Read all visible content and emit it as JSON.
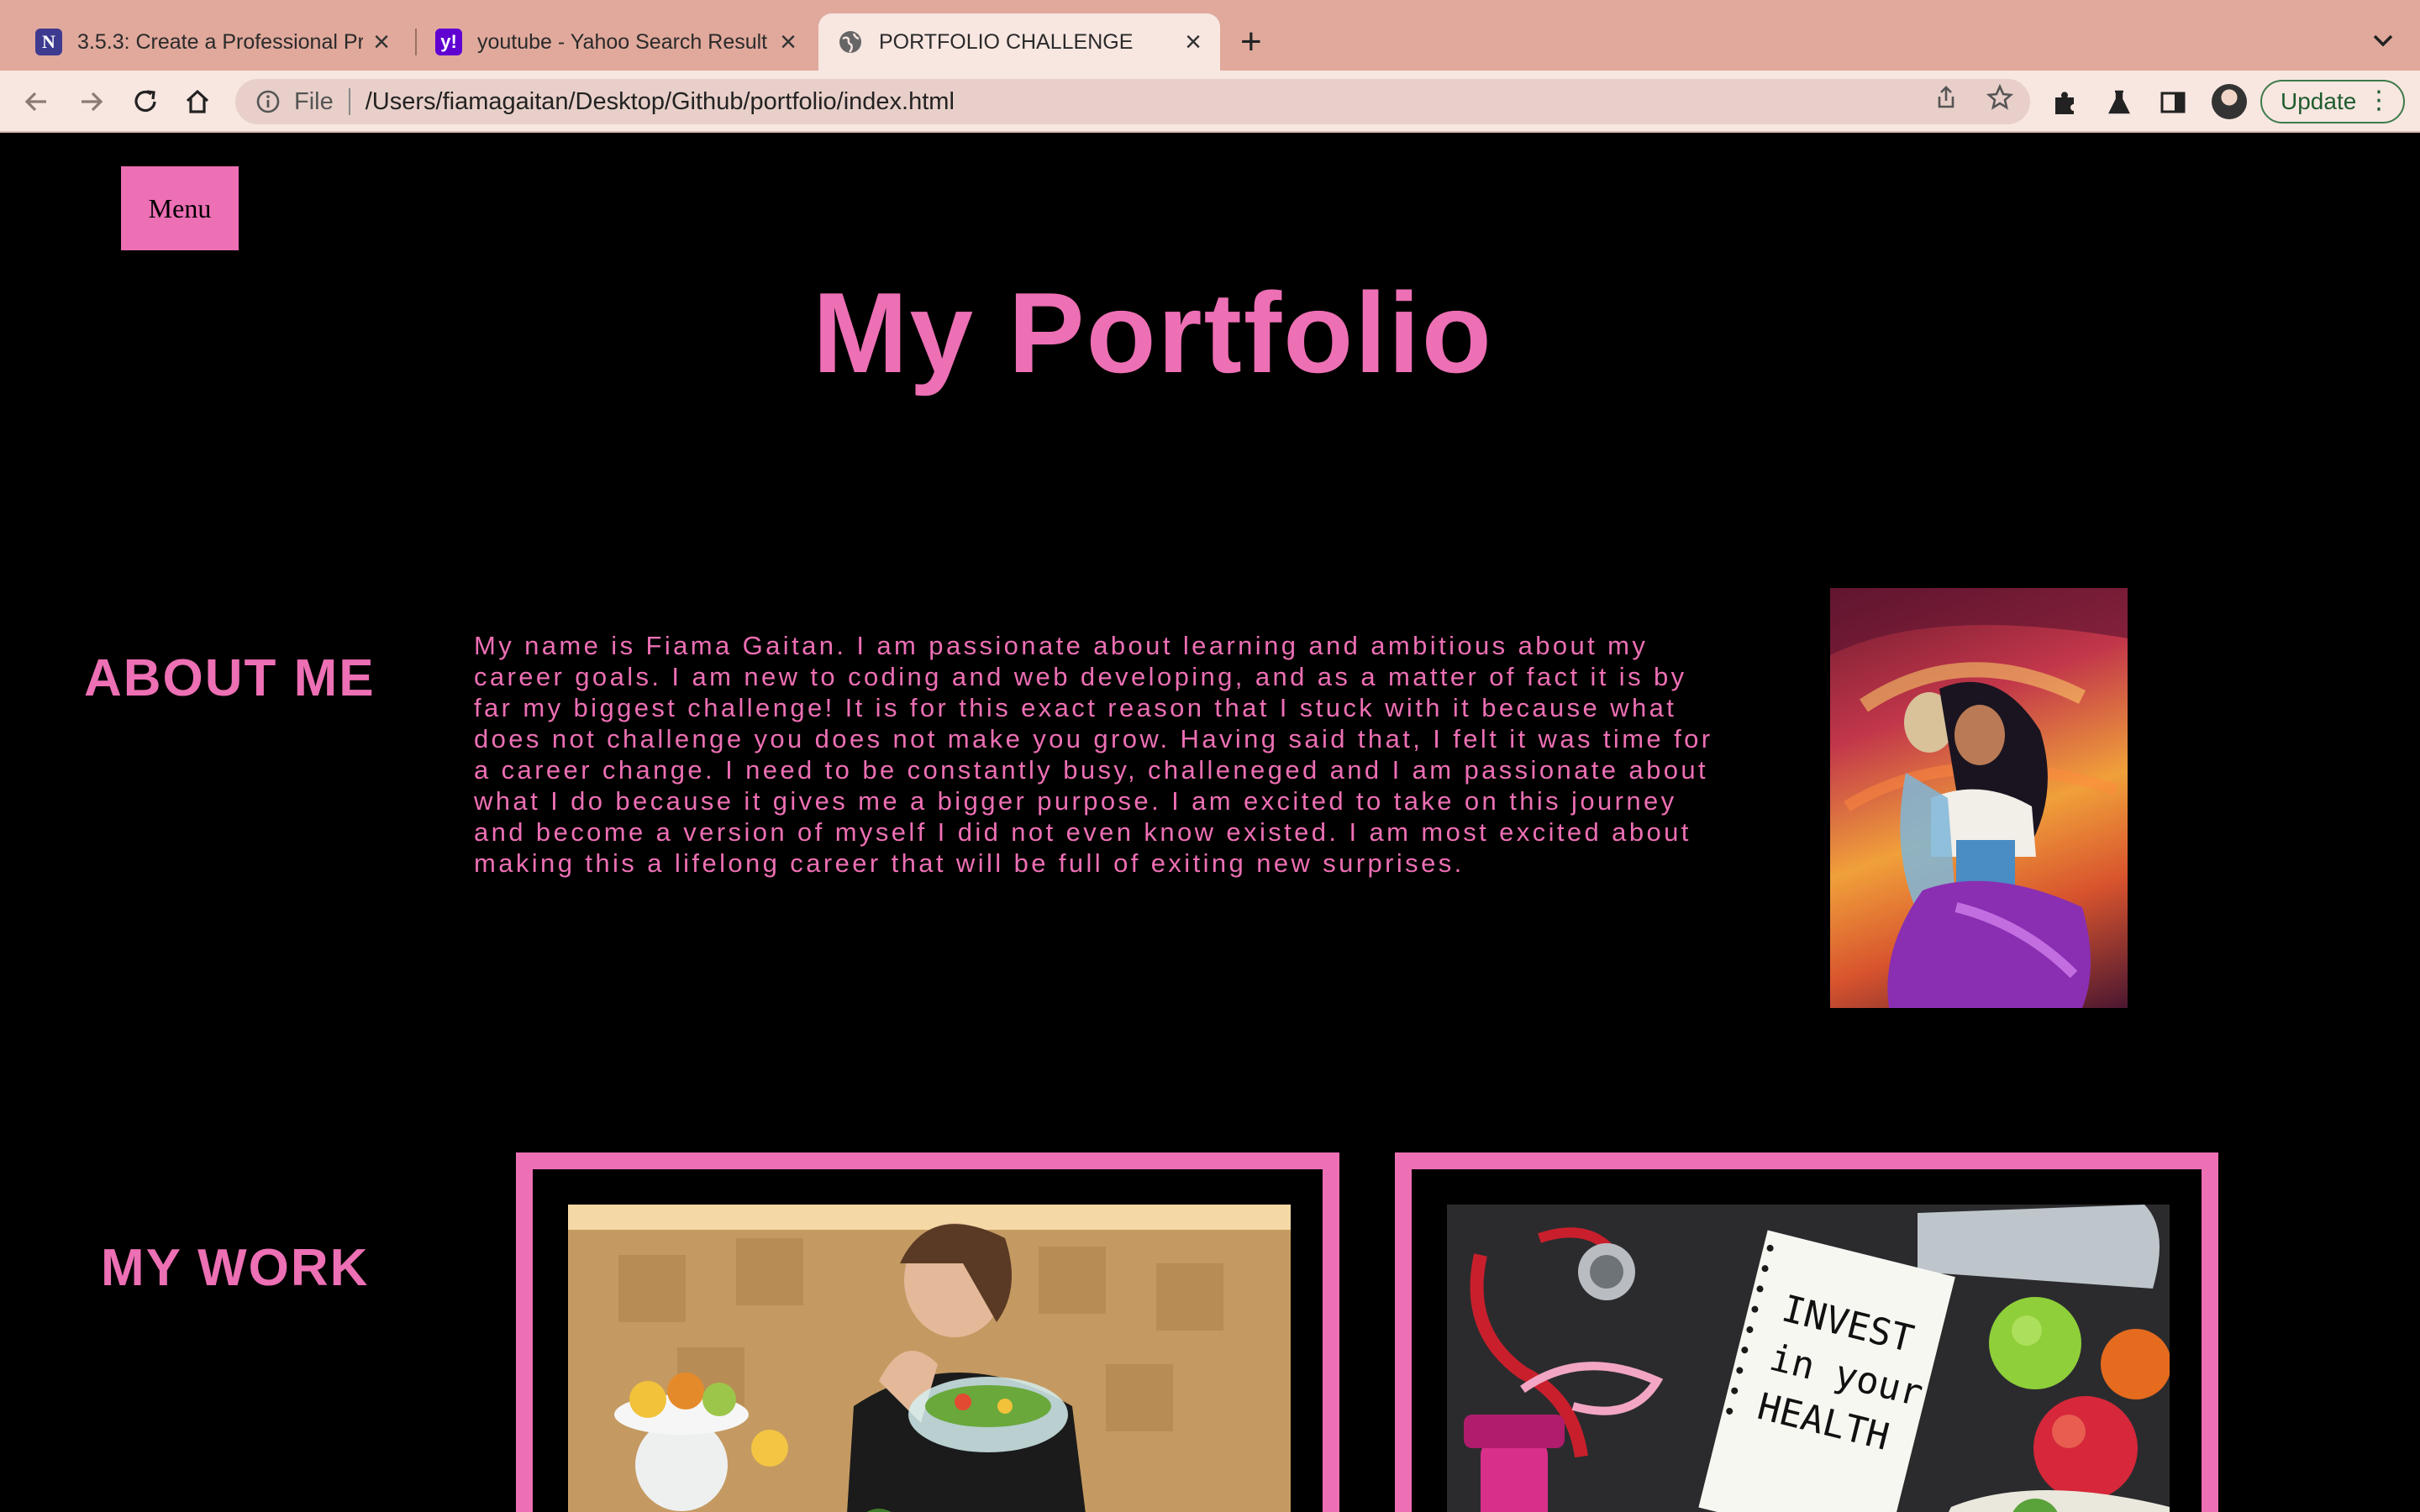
{
  "browser": {
    "tabs": [
      {
        "title": "3.5.3: Create a Professional Pr",
        "favicon": "N",
        "active": false
      },
      {
        "title": "youtube - Yahoo Search Result",
        "favicon": "y!",
        "active": false
      },
      {
        "title": "PORTFOLIO CHALLENGE",
        "favicon": "globe-icon",
        "active": true
      }
    ],
    "address_scheme": "File",
    "address_path": "/Users/fiamagaitan/Desktop/Github/portfolio/index.html",
    "update_label": "Update"
  },
  "page": {
    "menu_label": "Menu",
    "title": "My Portfolio",
    "about_heading": "ABOUT ME",
    "about_text": "My name is Fiama Gaitan. I am passionate about learning and ambitious about my career goals. I am new to coding and web developing, and as a matter of fact it is by far my biggest challenge! It is for this exact reason that I stuck with it because what does not challenge you does not make you grow. Having said that, I felt it was time for a career change. I need to be constantly busy, challeneged and I am passionate about what I do because it gives me a bigger purpose. I am excited to take on this journey and become a version of myself I did not even know existed. I am most excited about making this a lifelong career that will be full of exiting new surprises.",
    "work_heading": "MY WORK",
    "notebook_text": [
      "INVEST",
      "in your",
      "HEALTH"
    ]
  },
  "colors": {
    "accent": "#ed6fb4",
    "background": "#000000",
    "tabbar": "#e0a99c",
    "toolbar": "#f8e6e1"
  }
}
